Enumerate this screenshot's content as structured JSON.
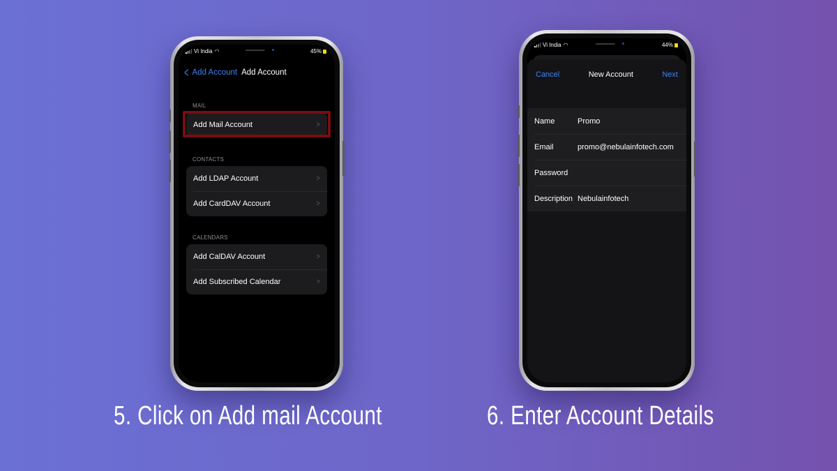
{
  "colors": {
    "background_left": "#6B70D5",
    "background_right": "#7452AE",
    "ios_blue": "#3b82f6",
    "highlight_red": "#7a0c10"
  },
  "left_phone": {
    "status": {
      "carrier": "Vi India",
      "battery": "45%"
    },
    "nav": {
      "back_label": "Add Account",
      "title": "Add Account"
    },
    "sections": [
      {
        "header": "MAIL",
        "items": [
          "Add Mail Account"
        ]
      },
      {
        "header": "CONTACTS",
        "items": [
          "Add LDAP Account",
          "Add CardDAV Account"
        ]
      },
      {
        "header": "CALENDARS",
        "items": [
          "Add CalDAV Account",
          "Add Subscribed Calendar"
        ]
      }
    ],
    "highlighted_item": "Add Mail Account"
  },
  "right_phone": {
    "status": {
      "carrier": "Vi India",
      "battery": "44%"
    },
    "nav": {
      "cancel_label": "Cancel",
      "title": "New Account",
      "next_label": "Next"
    },
    "fields": [
      {
        "label": "Name",
        "value": "Promo"
      },
      {
        "label": "Email",
        "value": "promo@nebulainfotech.com"
      },
      {
        "label": "Password",
        "value": ""
      },
      {
        "label": "Description",
        "value": "Nebulainfotech"
      }
    ]
  },
  "captions": {
    "step5": "5. Click on Add mail Account",
    "step6": "6. Enter Account Details"
  }
}
